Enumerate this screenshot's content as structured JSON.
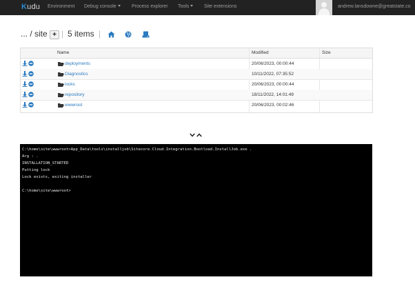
{
  "navbar": {
    "brand_prefix": "K",
    "brand_rest": "udu",
    "items": [
      {
        "label": "Environment",
        "dropdown": false
      },
      {
        "label": "Debug console",
        "dropdown": true
      },
      {
        "label": "Process explorer",
        "dropdown": false
      },
      {
        "label": "Tools",
        "dropdown": true
      },
      {
        "label": "Site extensions",
        "dropdown": false
      }
    ],
    "user": "andrew.lansdowne@greatstate.co"
  },
  "breadcrumb": {
    "path": "... / site",
    "add_label": "+",
    "separator": "|",
    "item_count": "5 items",
    "icons": [
      "home-icon",
      "globe-icon",
      "drive-icon"
    ]
  },
  "files": {
    "columns": {
      "name": "Name",
      "modified": "Modified",
      "size": "Size"
    },
    "rows": [
      {
        "name": "deployments",
        "modified": "20/06/2023, 00:00:44",
        "size": ""
      },
      {
        "name": "Diagnostics",
        "modified": "10/11/2022, 07:35:52",
        "size": ""
      },
      {
        "name": "locks",
        "modified": "20/06/2023, 00:00:44",
        "size": ""
      },
      {
        "name": "repository",
        "modified": "18/11/2022, 14:01:49",
        "size": ""
      },
      {
        "name": "wwwroot",
        "modified": "20/06/2023, 00:02:46",
        "size": ""
      }
    ]
  },
  "console": {
    "lines": [
      "C:\\home\\site\\wwwroot>App_Data\\tools\\installjob\\Sitecore.Cloud.Integration.Bootload.InstallJob.exe .",
      "Arg : .",
      "INSTALLATION_STARTED",
      "Putting lock",
      "Lock exists, exiting installer",
      "",
      "C:\\home\\site\\wwwroot>"
    ]
  },
  "colors": {
    "accent": "#2a8ccf",
    "navbar": "#222222",
    "link": "#2a7ac0",
    "console_bg": "#000000"
  }
}
